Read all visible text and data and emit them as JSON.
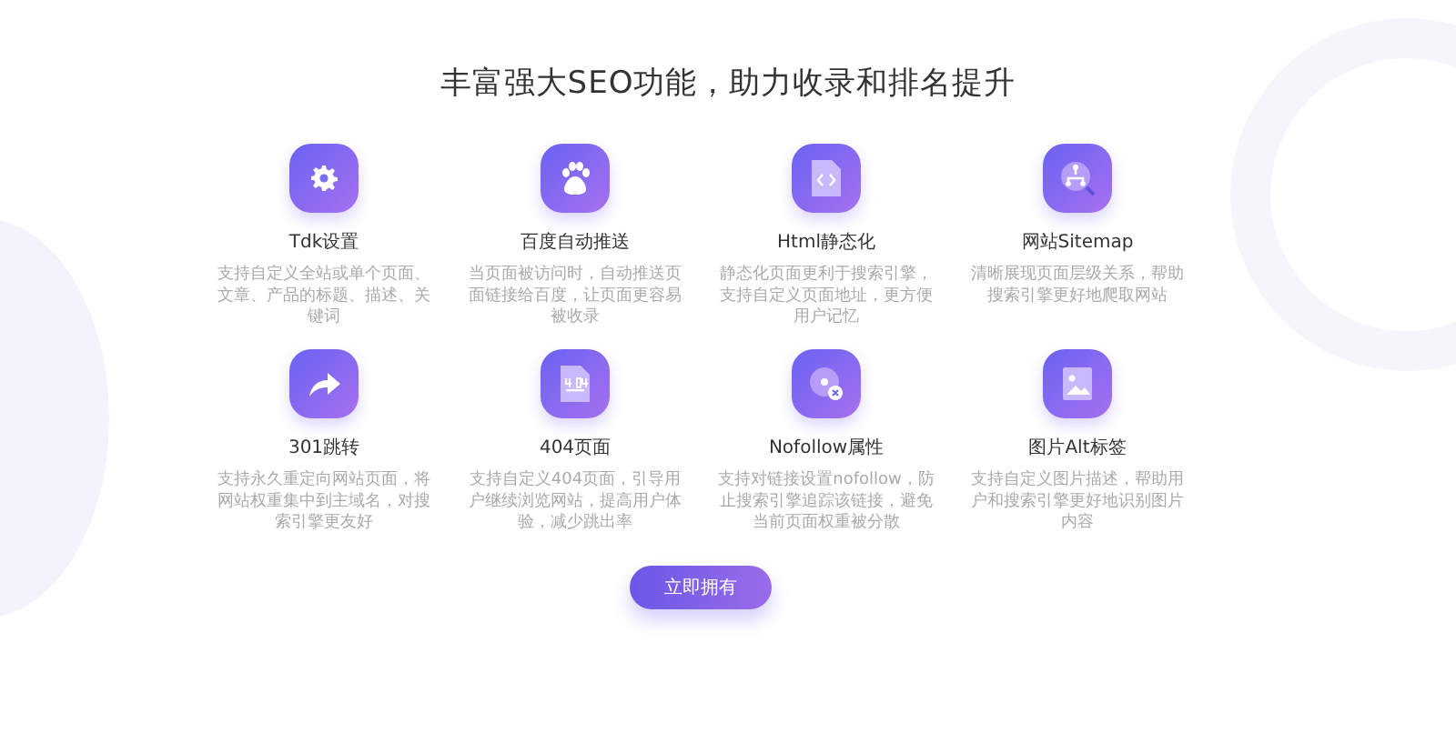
{
  "heading": "丰富强大SEO功能，助力收录和排名提升",
  "features": [
    {
      "title": "Tdk设置",
      "desc": "支持自定义全站或单个页面、文章、产品的标题、描述、关键词"
    },
    {
      "title": "百度自动推送",
      "desc": "当页面被访问时，自动推送页面链接给百度，让页面更容易被收录"
    },
    {
      "title": "Html静态化",
      "desc": "静态化页面更利于搜索引擎，支持自定义页面地址，更方便用户记忆"
    },
    {
      "title": "网站Sitemap",
      "desc": "清晰展现页面层级关系，帮助搜索引擎更好地爬取网站"
    },
    {
      "title": "301跳转",
      "desc": "支持永久重定向网站页面，将网站权重集中到主域名，对搜索引擎更友好"
    },
    {
      "title": "404页面",
      "desc": "支持自定义404页面，引导用户继续浏览网站，提高用户体验，减少跳出率"
    },
    {
      "title": "Nofollow属性",
      "desc": "支持对链接设置nofollow，防止搜索引擎追踪该链接，避免当前页面权重被分散"
    },
    {
      "title": "图片Alt标签",
      "desc": "支持自定义图片描述，帮助用户和搜索引擎更好地识别图片内容"
    }
  ],
  "button": "立即拥有"
}
